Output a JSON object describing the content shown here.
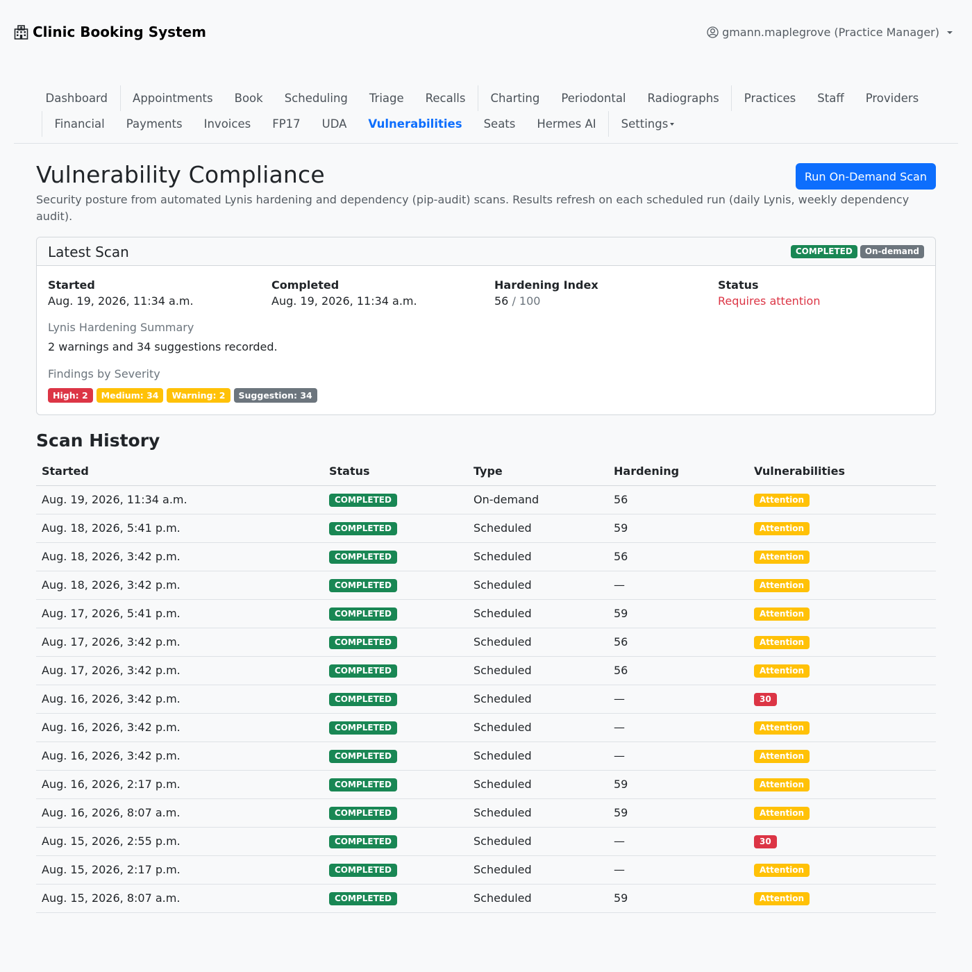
{
  "app": {
    "brand": "Clinic Booking System",
    "user": "gmann.maplegrove (Practice Manager)"
  },
  "nav": {
    "row1": [
      {
        "label": "Dashboard"
      },
      {
        "sep": true
      },
      {
        "label": "Appointments"
      },
      {
        "label": "Book"
      },
      {
        "label": "Scheduling"
      },
      {
        "label": "Triage"
      },
      {
        "label": "Recalls"
      },
      {
        "sep": true
      },
      {
        "label": "Charting"
      },
      {
        "label": "Periodontal"
      },
      {
        "label": "Radiographs"
      },
      {
        "sep": true
      },
      {
        "label": "Practices"
      },
      {
        "label": "Staff"
      },
      {
        "label": "Providers"
      }
    ],
    "row2": [
      {
        "sep": true
      },
      {
        "label": "Financial"
      },
      {
        "label": "Payments"
      },
      {
        "label": "Invoices"
      },
      {
        "label": "FP17"
      },
      {
        "label": "UDA"
      },
      {
        "label": "Vulnerabilities",
        "active": true
      },
      {
        "label": "Seats"
      },
      {
        "label": "Hermes AI"
      },
      {
        "sep": true
      },
      {
        "label": "Settings",
        "dropdown": true
      }
    ]
  },
  "page": {
    "title": "Vulnerability Compliance",
    "run_button": "Run On-Demand Scan",
    "lead": "Security posture from automated Lynis hardening and dependency (pip-audit) scans. Results refresh on each scheduled run (daily Lynis, weekly dependency audit)."
  },
  "latest_scan": {
    "title": "Latest Scan",
    "status_badge": "COMPLETED",
    "type_badge": "On-demand",
    "started_label": "Started",
    "started": "Aug. 19, 2026, 11:34 a.m.",
    "completed_label": "Completed",
    "completed": "Aug. 19, 2026, 11:34 a.m.",
    "hardening_label": "Hardening Index",
    "hardening_value": "56",
    "hardening_max": "/ 100",
    "status_label": "Status",
    "status_value": "Requires attention",
    "summary_heading": "Lynis Hardening Summary",
    "summary_text": "2 warnings and 34 suggestions recorded.",
    "severity_heading": "Findings by Severity",
    "severity": [
      {
        "label": "High: 2",
        "color": "#dc3545"
      },
      {
        "label": "Medium: 34",
        "color": "#ffc107"
      },
      {
        "label": "Warning: 2",
        "color": "#ffc107"
      },
      {
        "label": "Suggestion: 34",
        "color": "#6c757d"
      }
    ]
  },
  "history": {
    "title": "Scan History",
    "columns": [
      "Started",
      "Status",
      "Type",
      "Hardening",
      "Vulnerabilities"
    ],
    "rows": [
      {
        "started": "Aug. 19, 2026, 11:34 a.m.",
        "status": "COMPLETED",
        "type": "On-demand",
        "hardening": "56",
        "vuln": "Attention",
        "vuln_kind": "warning"
      },
      {
        "started": "Aug. 18, 2026, 5:41 p.m.",
        "status": "COMPLETED",
        "type": "Scheduled",
        "hardening": "59",
        "vuln": "Attention",
        "vuln_kind": "warning"
      },
      {
        "started": "Aug. 18, 2026, 3:42 p.m.",
        "status": "COMPLETED",
        "type": "Scheduled",
        "hardening": "56",
        "vuln": "Attention",
        "vuln_kind": "warning"
      },
      {
        "started": "Aug. 18, 2026, 3:42 p.m.",
        "status": "COMPLETED",
        "type": "Scheduled",
        "hardening": "—",
        "vuln": "Attention",
        "vuln_kind": "warning"
      },
      {
        "started": "Aug. 17, 2026, 5:41 p.m.",
        "status": "COMPLETED",
        "type": "Scheduled",
        "hardening": "59",
        "vuln": "Attention",
        "vuln_kind": "warning"
      },
      {
        "started": "Aug. 17, 2026, 3:42 p.m.",
        "status": "COMPLETED",
        "type": "Scheduled",
        "hardening": "56",
        "vuln": "Attention",
        "vuln_kind": "warning"
      },
      {
        "started": "Aug. 17, 2026, 3:42 p.m.",
        "status": "COMPLETED",
        "type": "Scheduled",
        "hardening": "56",
        "vuln": "Attention",
        "vuln_kind": "warning"
      },
      {
        "started": "Aug. 16, 2026, 3:42 p.m.",
        "status": "COMPLETED",
        "type": "Scheduled",
        "hardening": "—",
        "vuln": "30",
        "vuln_kind": "danger"
      },
      {
        "started": "Aug. 16, 2026, 3:42 p.m.",
        "status": "COMPLETED",
        "type": "Scheduled",
        "hardening": "—",
        "vuln": "Attention",
        "vuln_kind": "warning"
      },
      {
        "started": "Aug. 16, 2026, 3:42 p.m.",
        "status": "COMPLETED",
        "type": "Scheduled",
        "hardening": "—",
        "vuln": "Attention",
        "vuln_kind": "warning"
      },
      {
        "started": "Aug. 16, 2026, 2:17 p.m.",
        "status": "COMPLETED",
        "type": "Scheduled",
        "hardening": "59",
        "vuln": "Attention",
        "vuln_kind": "warning"
      },
      {
        "started": "Aug. 16, 2026, 8:07 a.m.",
        "status": "COMPLETED",
        "type": "Scheduled",
        "hardening": "59",
        "vuln": "Attention",
        "vuln_kind": "warning"
      },
      {
        "started": "Aug. 15, 2026, 2:55 p.m.",
        "status": "COMPLETED",
        "type": "Scheduled",
        "hardening": "—",
        "vuln": "30",
        "vuln_kind": "danger"
      },
      {
        "started": "Aug. 15, 2026, 2:17 p.m.",
        "status": "COMPLETED",
        "type": "Scheduled",
        "hardening": "—",
        "vuln": "Attention",
        "vuln_kind": "warning"
      },
      {
        "started": "Aug. 15, 2026, 8:07 a.m.",
        "status": "COMPLETED",
        "type": "Scheduled",
        "hardening": "59",
        "vuln": "Attention",
        "vuln_kind": "warning"
      }
    ]
  }
}
